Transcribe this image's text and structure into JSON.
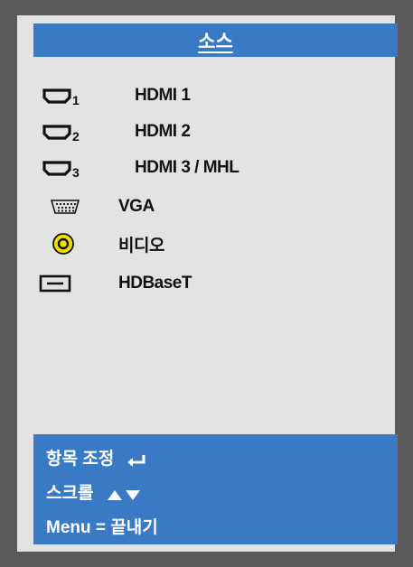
{
  "menu": {
    "title": "소스",
    "sources": [
      {
        "label": "HDMI 1",
        "icon": "hdmi-port-icon",
        "sub": "1"
      },
      {
        "label": "HDMI 2",
        "icon": "hdmi-port-icon",
        "sub": "2"
      },
      {
        "label": "HDMI 3 / MHL",
        "icon": "hdmi-port-icon",
        "sub": "3"
      },
      {
        "label": "VGA",
        "icon": "vga-port-icon"
      },
      {
        "label": "비디오",
        "icon": "rca-video-icon"
      },
      {
        "label": "HDBaseT",
        "icon": "hdbaset-port-icon"
      }
    ]
  },
  "footer": {
    "adjust_label": "항목 조정",
    "adjust_icon": "enter-icon",
    "scroll_label": "스크롤",
    "scroll_icon": "up-down-arrows-icon",
    "exit_label": "Menu = 끝내기"
  },
  "colors": {
    "frame": "#5a5a5a",
    "panel": "#e3e3e3",
    "accent": "#3a7ac4",
    "rca_yellow": "#f2e100"
  }
}
